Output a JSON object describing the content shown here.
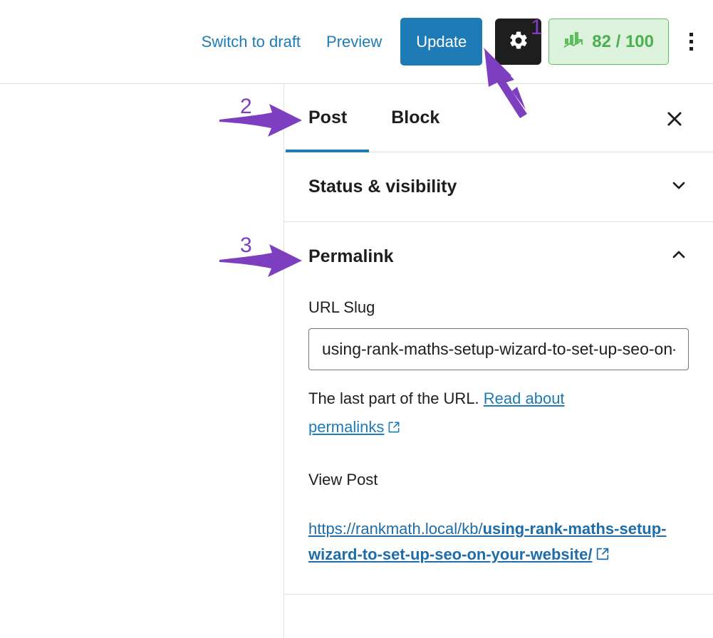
{
  "toolbar": {
    "switch_to_draft_label": "Switch to draft",
    "preview_label": "Preview",
    "update_label": "Update",
    "settings_icon": "gear-icon",
    "seo_score_label": "82 / 100",
    "seo_icon": "seo-bar-chart-icon",
    "more_options_icon": "kebab-menu-icon"
  },
  "sidebar": {
    "tabs": [
      {
        "label": "Post",
        "active": true
      },
      {
        "label": "Block",
        "active": false
      }
    ],
    "close_icon": "close-icon",
    "panels": [
      {
        "title": "Status & visibility",
        "expanded": false,
        "toggle_icon": "chevron-down-icon"
      },
      {
        "title": "Permalink",
        "expanded": true,
        "toggle_icon": "chevron-up-icon"
      }
    ],
    "permalink": {
      "slug_label": "URL Slug",
      "slug_value": "using-rank-maths-setup-wizard-to-set-up-seo-on-your-website",
      "slug_placeholder": "using-rank-maths-setup-wizard-to-set-u",
      "help_text": "The last part of the URL. ",
      "help_link_label": "Read about permalinks",
      "help_link_icon": "external-link-icon",
      "view_post_label": "View Post",
      "post_url_base": "https://rankmath.local/kb/",
      "post_url_slug": "using-rank-maths-setup-wizard-to-set-up-seo-on-your-website/",
      "post_url_icon": "external-link-icon"
    }
  },
  "annotations": {
    "color": "#7e3ec0",
    "markers": [
      {
        "number": "1",
        "target": "settings-gear-button"
      },
      {
        "number": "2",
        "target": "post-tab"
      },
      {
        "number": "3",
        "target": "permalink-panel-header"
      }
    ]
  },
  "colors": {
    "link_blue": "#1e7bb5",
    "button_blue": "#1e7bb5",
    "seo_green": "#4caf50",
    "seo_green_bg": "#ddf2dd",
    "annotation_purple": "#7e3ec0",
    "dark": "#1e1e1e"
  }
}
